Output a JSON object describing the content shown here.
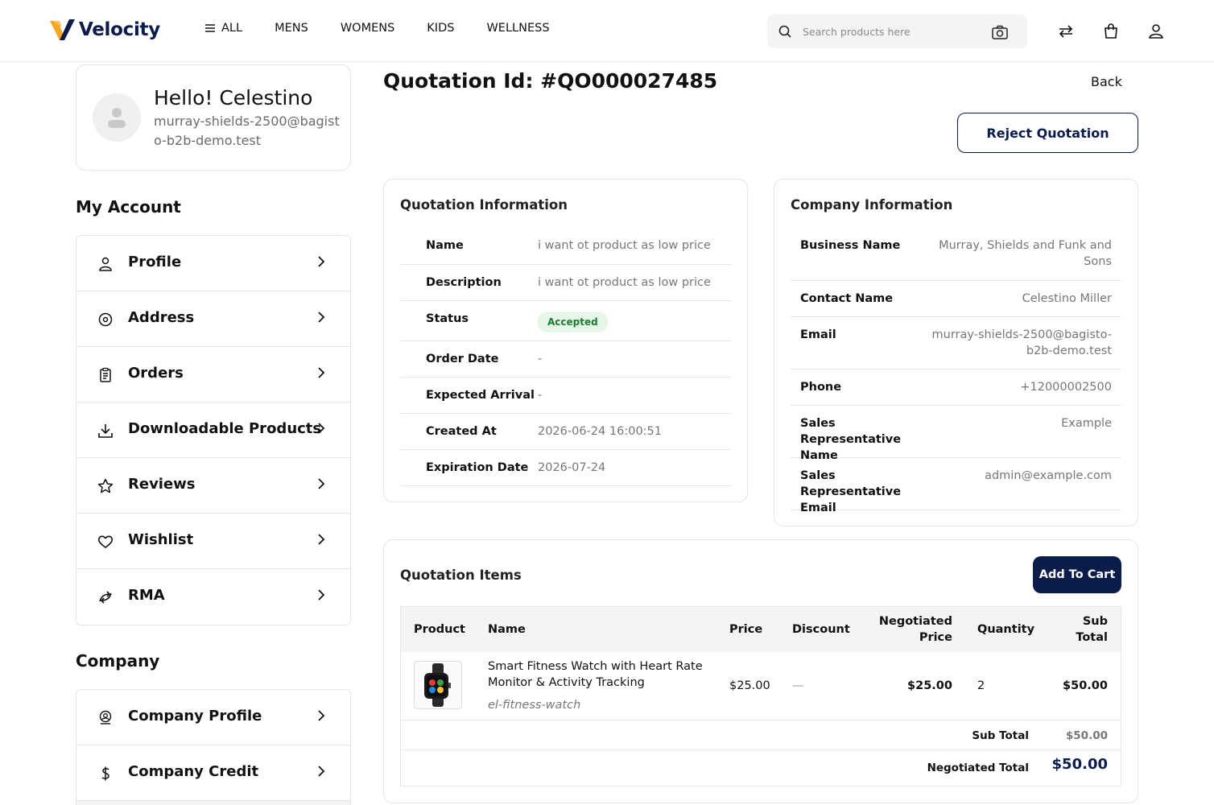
{
  "header": {
    "brand": "Velocity",
    "nav": [
      "ALL",
      "MENS",
      "WOMENS",
      "KIDS",
      "WELLNESS"
    ],
    "search_placeholder": "Search products here"
  },
  "profile": {
    "greeting": "Hello! Celestino",
    "email": "murray-shields-2500@bagisto-b2b-demo.test"
  },
  "account": {
    "title": "My Account",
    "items": [
      "Profile",
      "Address",
      "Orders",
      "Downloadable Products",
      "Reviews",
      "Wishlist",
      "RMA"
    ]
  },
  "company": {
    "title": "Company",
    "items": [
      "Company Profile",
      "Company Credit"
    ]
  },
  "quotation": {
    "id_label": "Quotation Id: #QO000027485",
    "back": "Back",
    "reject": "Reject Quotation"
  },
  "quotation_info": {
    "title": "Quotation Information",
    "rows": [
      {
        "label": "Name",
        "value": "i want ot product as low price"
      },
      {
        "label": "Description",
        "value": "i want ot product as low price"
      },
      {
        "label": "Status",
        "value": "Accepted"
      },
      {
        "label": "Order Date",
        "value": "-"
      },
      {
        "label": "Expected Arrival",
        "value": "-"
      },
      {
        "label": "Created At",
        "value": "2026-06-24 16:00:51"
      },
      {
        "label": "Expiration Date",
        "value": "2026-07-24"
      }
    ]
  },
  "company_info": {
    "title": "Company Information",
    "rows": [
      {
        "label": "Business Name",
        "value": "Murray, Shields and Funk and Sons"
      },
      {
        "label": "Contact Name",
        "value": "Celestino Miller"
      },
      {
        "label": "Email",
        "value": "murray-shields-2500@bagisto-b2b-demo.test"
      },
      {
        "label": "Phone",
        "value": "+12000002500"
      },
      {
        "label": "Sales Representative Name",
        "value": "Example"
      },
      {
        "label": "Sales Representative Email",
        "value": "admin@example.com"
      }
    ]
  },
  "items": {
    "title": "Quotation Items",
    "add_to_cart": "Add To Cart",
    "columns": [
      "Product",
      "Name",
      "Price",
      "Discount",
      "Negotiated Price",
      "Quantity",
      "Sub Total"
    ],
    "rows": [
      {
        "name": "Smart Fitness Watch with Heart Rate Monitor & Activity Tracking",
        "sku": "el-fitness-watch",
        "price": "$25.00",
        "discount": "—",
        "negotiated_price": "$25.00",
        "quantity": "2",
        "sub_total": "$50.00"
      }
    ],
    "subtotal_label": "Sub Total",
    "subtotal_value": "$50.00",
    "negotiated_total_label": "Negotiated Total",
    "negotiated_total_value": "$50.00"
  }
}
